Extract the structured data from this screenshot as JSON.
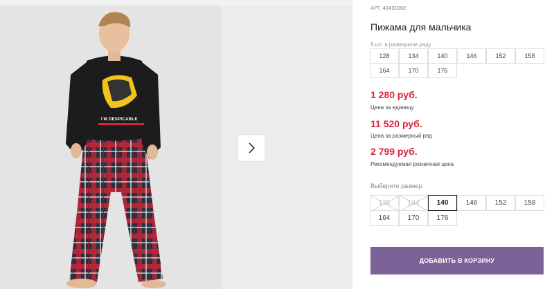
{
  "product": {
    "sku_label": "АРТ.",
    "sku": "42431002",
    "title": "Пижама для мальчика",
    "shirt_print": "I'M DESPICABLE"
  },
  "size_row": {
    "caption": "9 шт. в размерном ряду",
    "sizes": [
      "128",
      "134",
      "140",
      "146",
      "152",
      "158",
      "164",
      "170",
      "176"
    ]
  },
  "prices": {
    "unit_price": "1 280 руб.",
    "unit_label": "Цена за единицу",
    "row_price": "11 520 руб.",
    "row_label": "Цена за размерный ряд",
    "retail_price": "2 799 руб.",
    "retail_label": "Рекомендуемая розничная цена"
  },
  "size_picker": {
    "label": "Выберите размер:",
    "sizes": [
      {
        "value": "128",
        "state": "disabled"
      },
      {
        "value": "134",
        "state": "disabled"
      },
      {
        "value": "140",
        "state": "selected"
      },
      {
        "value": "146",
        "state": "available"
      },
      {
        "value": "152",
        "state": "available"
      },
      {
        "value": "158",
        "state": "available"
      },
      {
        "value": "164",
        "state": "available"
      },
      {
        "value": "170",
        "state": "available"
      },
      {
        "value": "176",
        "state": "available"
      }
    ]
  },
  "cart": {
    "add_label": "ДОБАВИТЬ В КОРЗИНУ"
  },
  "colors": {
    "price": "#d8243b",
    "button": "#7b6398",
    "shirt": "#1c1c1c",
    "plaid_red": "#b0283a",
    "plaid_dark": "#2b2f3d"
  },
  "icons": {
    "next": "chevron-right-icon",
    "unavailable": "cross-out-icon"
  }
}
